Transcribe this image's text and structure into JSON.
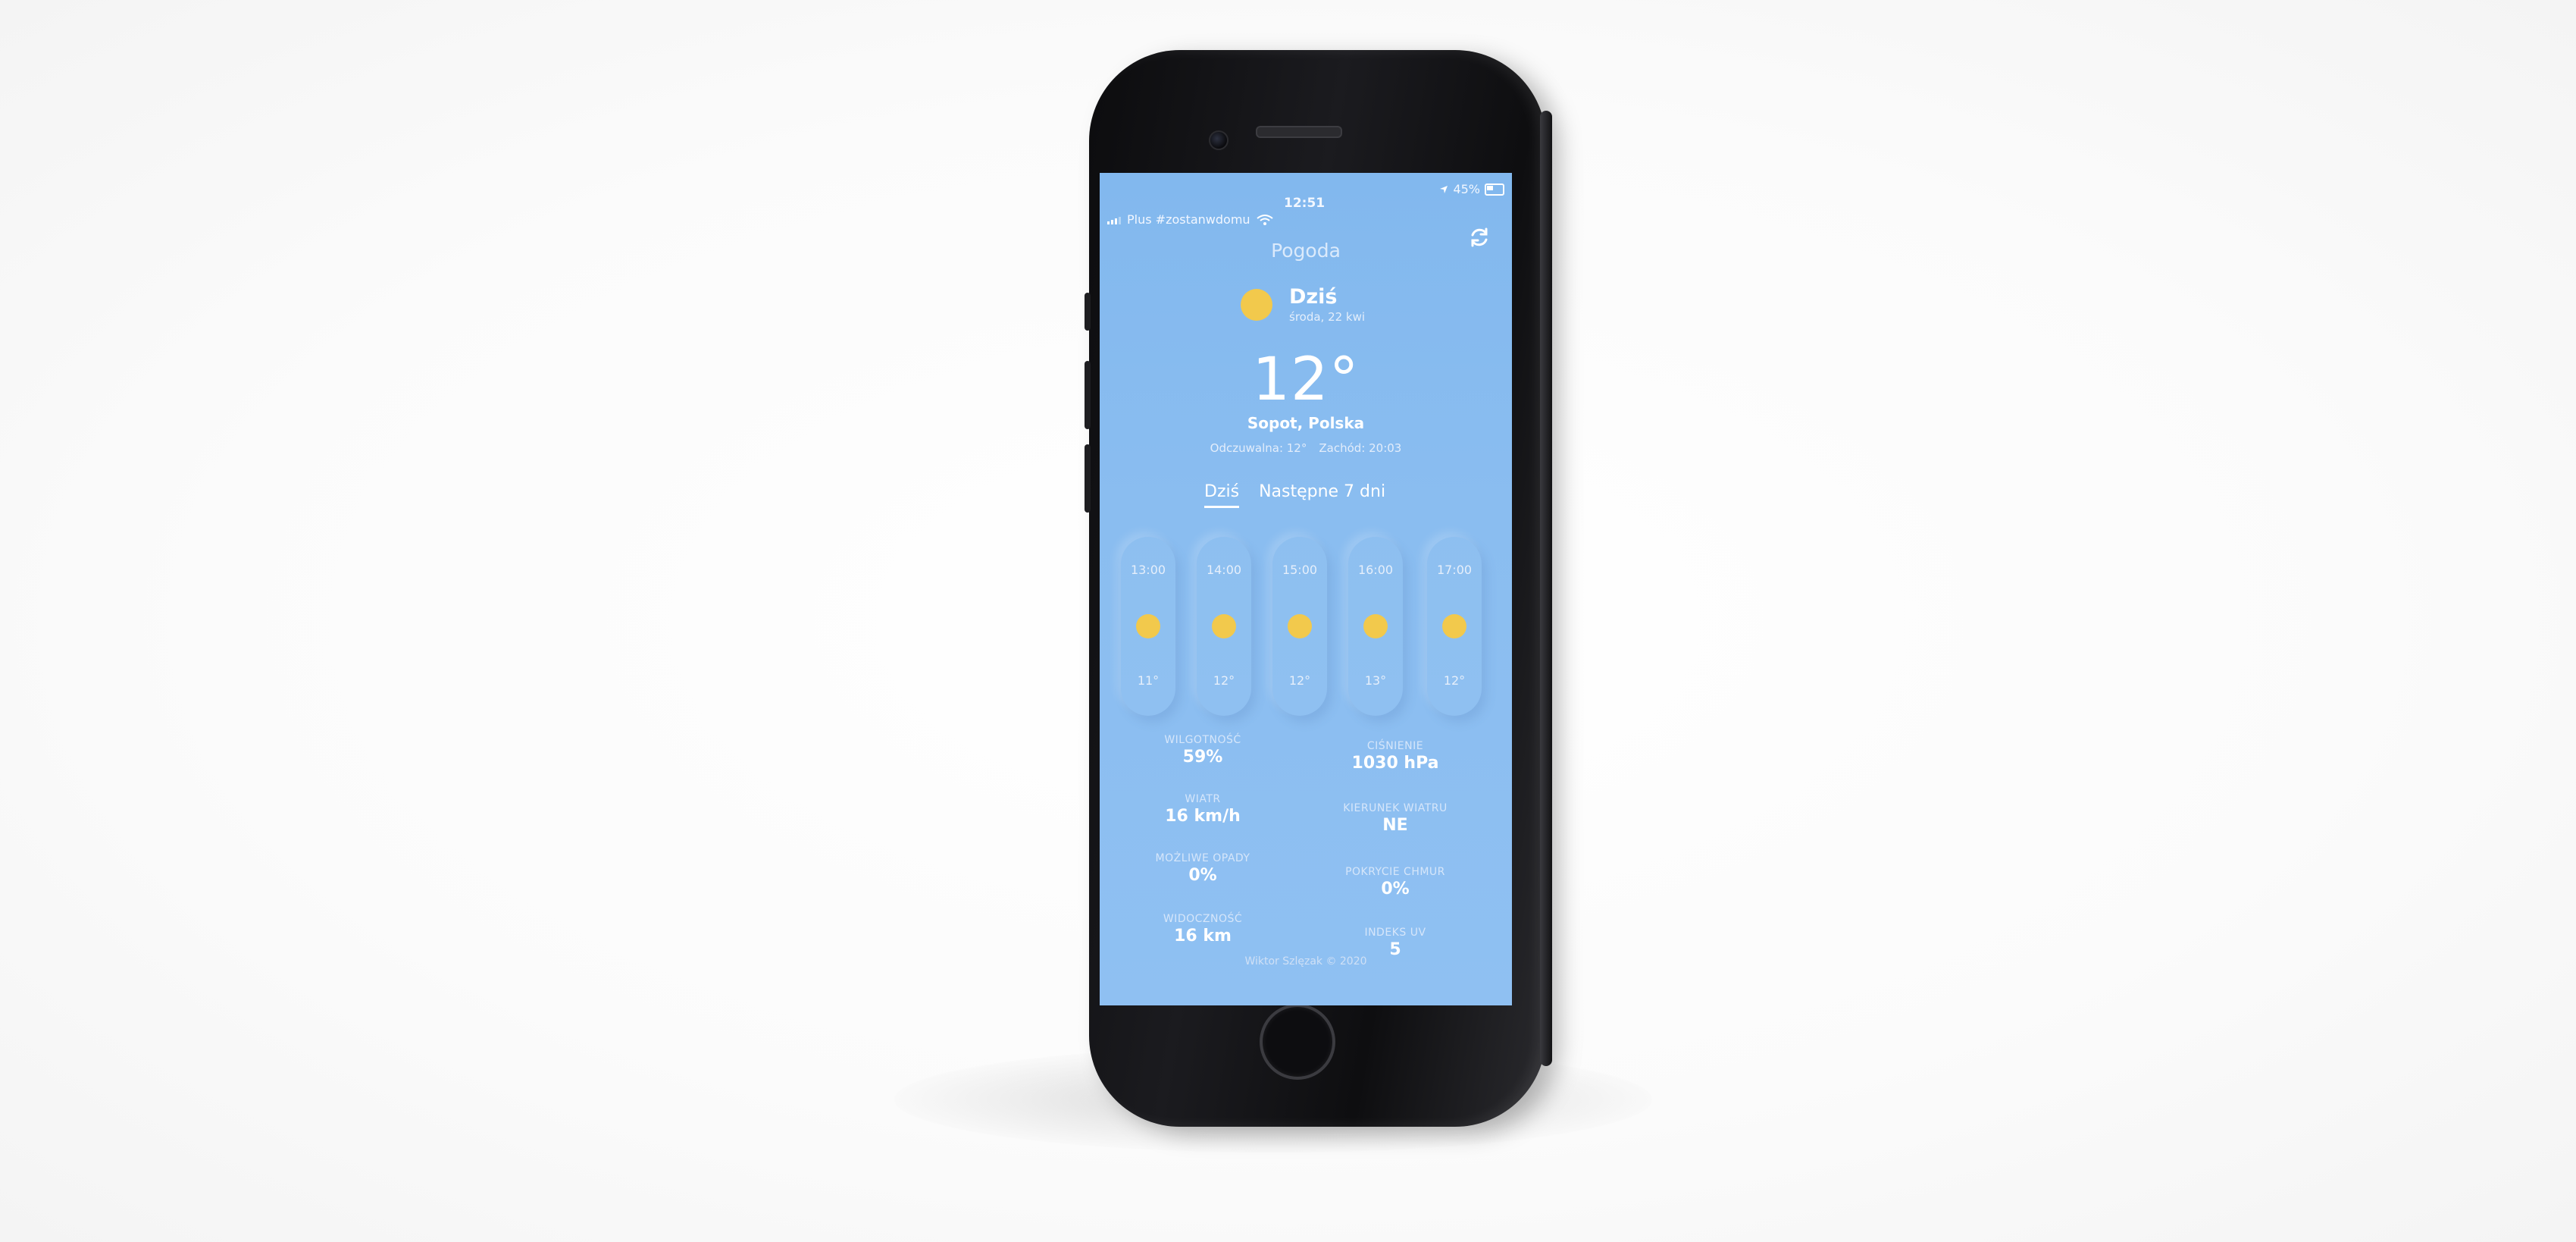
{
  "status_bar": {
    "carrier": "Plus #zostanwdomu",
    "time": "12:51",
    "battery": "45%"
  },
  "app": {
    "title": "Pogoda"
  },
  "today": {
    "day": "Dziś",
    "date": "środa, 22 kwi",
    "temperature": "12°",
    "location": "Sopot, Polska",
    "feels_like": "Odczuwalna: 12°",
    "sunset": "Zachód: 20:03"
  },
  "tabs": {
    "today": "Dziś",
    "next7": "Następne 7 dni"
  },
  "hourly": [
    {
      "hour": "13:00",
      "temp": "11°"
    },
    {
      "hour": "14:00",
      "temp": "12°"
    },
    {
      "hour": "15:00",
      "temp": "12°"
    },
    {
      "hour": "16:00",
      "temp": "13°"
    },
    {
      "hour": "17:00",
      "temp": "12°"
    }
  ],
  "stats": {
    "humidity": {
      "label": "WILGOTNOŚĆ",
      "value": "59%"
    },
    "pressure": {
      "label": "CIŚNIENIE",
      "value": "1030 hPa"
    },
    "wind": {
      "label": "WIATR",
      "value": "16 km/h"
    },
    "wind_direction": {
      "label": "KIERUNEK WIATRU",
      "value": "NE"
    },
    "precipitation": {
      "label": "MOŻLIWE OPADY",
      "value": "0%"
    },
    "cloud_cover": {
      "label": "POKRYCIE CHMUR",
      "value": "0%"
    },
    "visibility": {
      "label": "WIDOCZNOŚĆ",
      "value": "16 km"
    },
    "uv_index": {
      "label": "INDEKS UV",
      "value": "5"
    }
  },
  "footer": {
    "credit": "Wiktor Szlęzak © 2020"
  },
  "colors": {
    "screen_background": "#8abdf0",
    "sun": "#f2c94c",
    "text": "#ffffff"
  },
  "icons": {
    "refresh": "refresh-icon",
    "sun": "sun-icon",
    "wifi": "wifi-icon",
    "location": "location-arrow-icon",
    "battery": "battery-icon",
    "signal": "signal-icon"
  }
}
